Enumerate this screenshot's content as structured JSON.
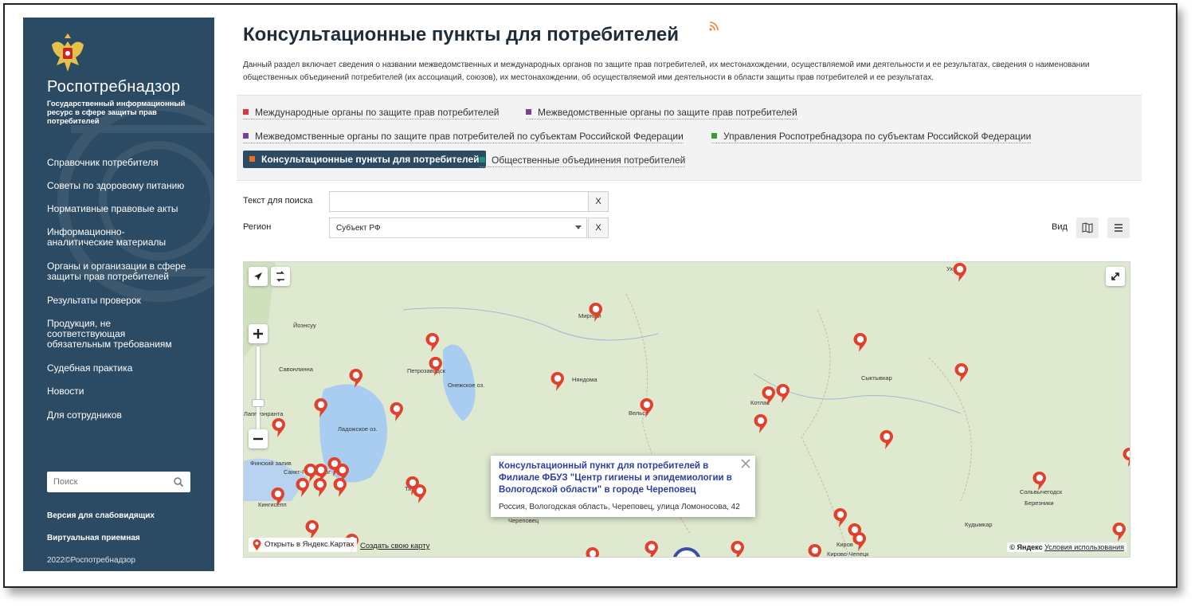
{
  "sidebar": {
    "brand": "Роспотребнадзор",
    "brand_sub": "Государственный информационный ресурс в сфере защиты прав потребителей",
    "items": [
      {
        "label": "Справочник потребителя"
      },
      {
        "label": "Советы по здоровому питанию"
      },
      {
        "label": "Нормативные правовые акты"
      },
      {
        "label": "Информационно-аналитические материалы"
      },
      {
        "label": "Органы и организации в сфере защиты прав потребителей"
      },
      {
        "label": "Результаты проверок"
      },
      {
        "label": "Продукция, не соответствующая обязательным требованиям"
      },
      {
        "label": "Судебная практика"
      },
      {
        "label": "Новости"
      },
      {
        "label": "Для сотрудников"
      }
    ],
    "search_placeholder": "Поиск",
    "accessibility_link": "Версия для слабовидящих",
    "reception_link": "Виртуальная приемная",
    "copyright": "2022©Роспотребнадзор"
  },
  "page": {
    "title": "Консультационные пункты для потребителей",
    "description": "Данный раздел включает сведения о названии межведомственных и международных органов по защите прав потребителей, их местонахождении, осуществляемой ими деятельности и ее результатах, сведения о наименовании общественных объединений потребителей (их ассоциаций, союзов), их местонахождении, об осуществляемой ими деятельности в области защиты прав потребителей и ее результатах."
  },
  "categories": [
    {
      "label": "Международные органы по защите прав потребителей",
      "color": "#d9363e"
    },
    {
      "label": "Межведомственные органы по защите прав потребителей",
      "color": "#7b3f98"
    },
    {
      "label": "Межведомственные органы по защите прав потребителей по субъектам Российской Федерации",
      "color": "#7b3f98"
    },
    {
      "label": "Управления Роспотребнадзора по субъектам Российской Федерации",
      "color": "#3a9a3a"
    },
    {
      "label": "Консультационные пункты для потребителей",
      "color": "#e8702a"
    },
    {
      "label": "Общественные объединения потребителей",
      "color": "#1f8f7a"
    }
  ],
  "filters": {
    "search_label": "Текст для поиска",
    "search_value": "",
    "region_label": "Регион",
    "region_value": "Субъект РФ",
    "clear_label": "X",
    "view_label": "Вид"
  },
  "map": {
    "cities": [
      "Йоэнсуу",
      "Савонлинна",
      "Лаппеэнранта",
      "Петрозаводск",
      "Онежское оз.",
      "Ладожское оз.",
      "Няндома",
      "Мирный",
      "Сыктывкар",
      "Вельск",
      "Котлас",
      "Финский залив",
      "Санкт-Петербург",
      "Кингисепп",
      "Тихвин",
      "Череповец",
      "Киров",
      "Кирово-Чепецк",
      "Сольвычегодск",
      "Березники",
      "Кудымкар",
      "Ухта"
    ],
    "balloon_title": "Консультационный пункт для потребителей в Филиале ФБУЗ \"Центр гигиены и эпидемиологии в Вологодской области\" в городе Череповец",
    "balloon_address": "Россия, Вологодская область, Череповец, улица Ломоносова, 42",
    "open_yandex": "Открыть в Яндекс.Картах",
    "create_map": "Создать свою карту",
    "copyright": "© Яндекс",
    "terms": "Условия использования",
    "pin_color": "#e0402c"
  }
}
